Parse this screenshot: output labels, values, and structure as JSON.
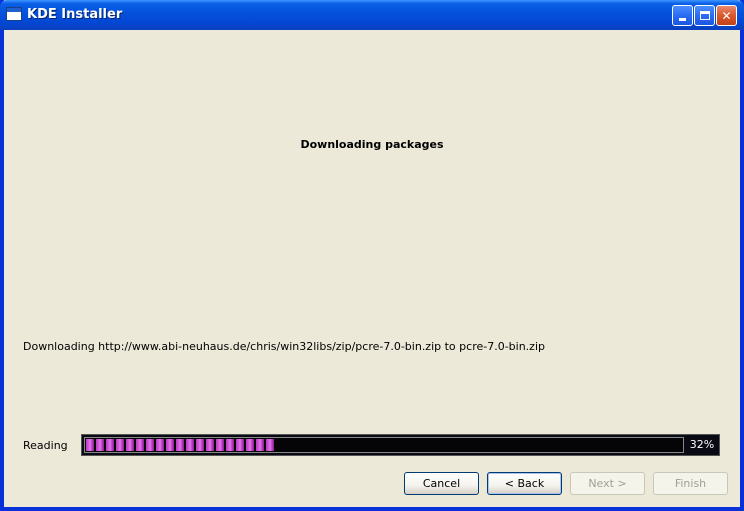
{
  "window": {
    "title": "KDE Installer"
  },
  "page": {
    "heading": "Downloading packages",
    "download_message": "Downloading http://www.abi-neuhaus.de/chris/win32libs/zip/pcre-7.0-bin.zip to pcre-7.0-bin.zip"
  },
  "progress": {
    "label": "Reading",
    "percent_text": "32%",
    "value": 0.32,
    "color": "#c23ec9"
  },
  "buttons": {
    "cancel": "Cancel",
    "back": "< Back",
    "next": "Next >",
    "finish": "Finish"
  },
  "icons": {
    "app": "window-icon",
    "minimize": "minimize-icon",
    "maximize": "maximize-icon",
    "close": "close-icon"
  }
}
